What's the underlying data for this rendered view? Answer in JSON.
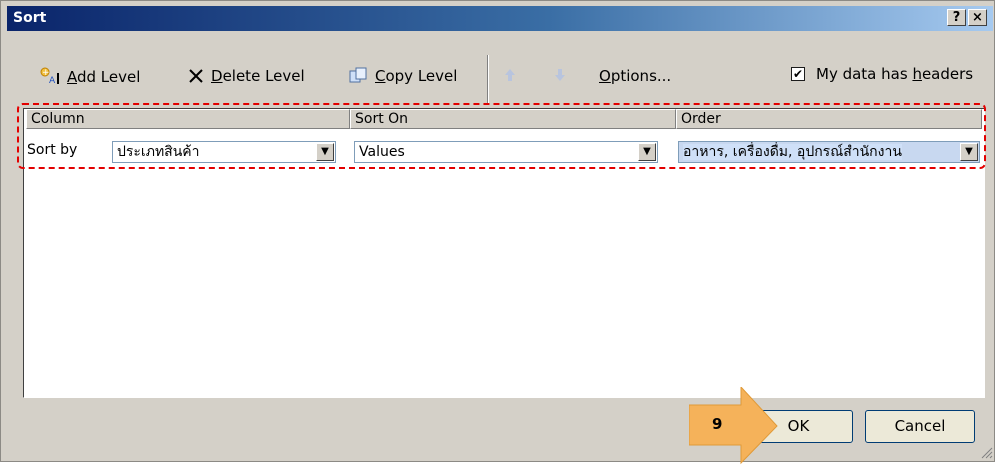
{
  "window": {
    "title": "Sort",
    "help_label": "?",
    "close_label": "×"
  },
  "toolbar": {
    "add_level": {
      "prefix": "",
      "accel": "A",
      "rest": "dd Level"
    },
    "delete_level": {
      "prefix": "",
      "accel": "D",
      "rest": "elete Level"
    },
    "copy_level": {
      "prefix": "",
      "accel": "C",
      "rest": "opy Level"
    },
    "options": {
      "prefix": "",
      "accel": "O",
      "rest": "ptions..."
    },
    "headers": {
      "prefix": "My data has ",
      "accel": "h",
      "rest": "eaders",
      "checked": "✔"
    }
  },
  "columns": {
    "column": "Column",
    "sort_on": "Sort On",
    "order": "Order"
  },
  "row": {
    "label": "Sort by",
    "column_value": "ประเภทสินค้า",
    "sort_on_value": "Values",
    "order_value": "อาหาร, เครื่องดื่ม, อุปกรณ์สำนักงาน"
  },
  "buttons": {
    "ok": "OK",
    "cancel": "Cancel"
  },
  "callout": {
    "step": "9",
    "color": "#f5b25a"
  },
  "colors": {
    "dash": "#e30000",
    "title_start": "#0a246a",
    "title_end": "#a6caf0"
  }
}
